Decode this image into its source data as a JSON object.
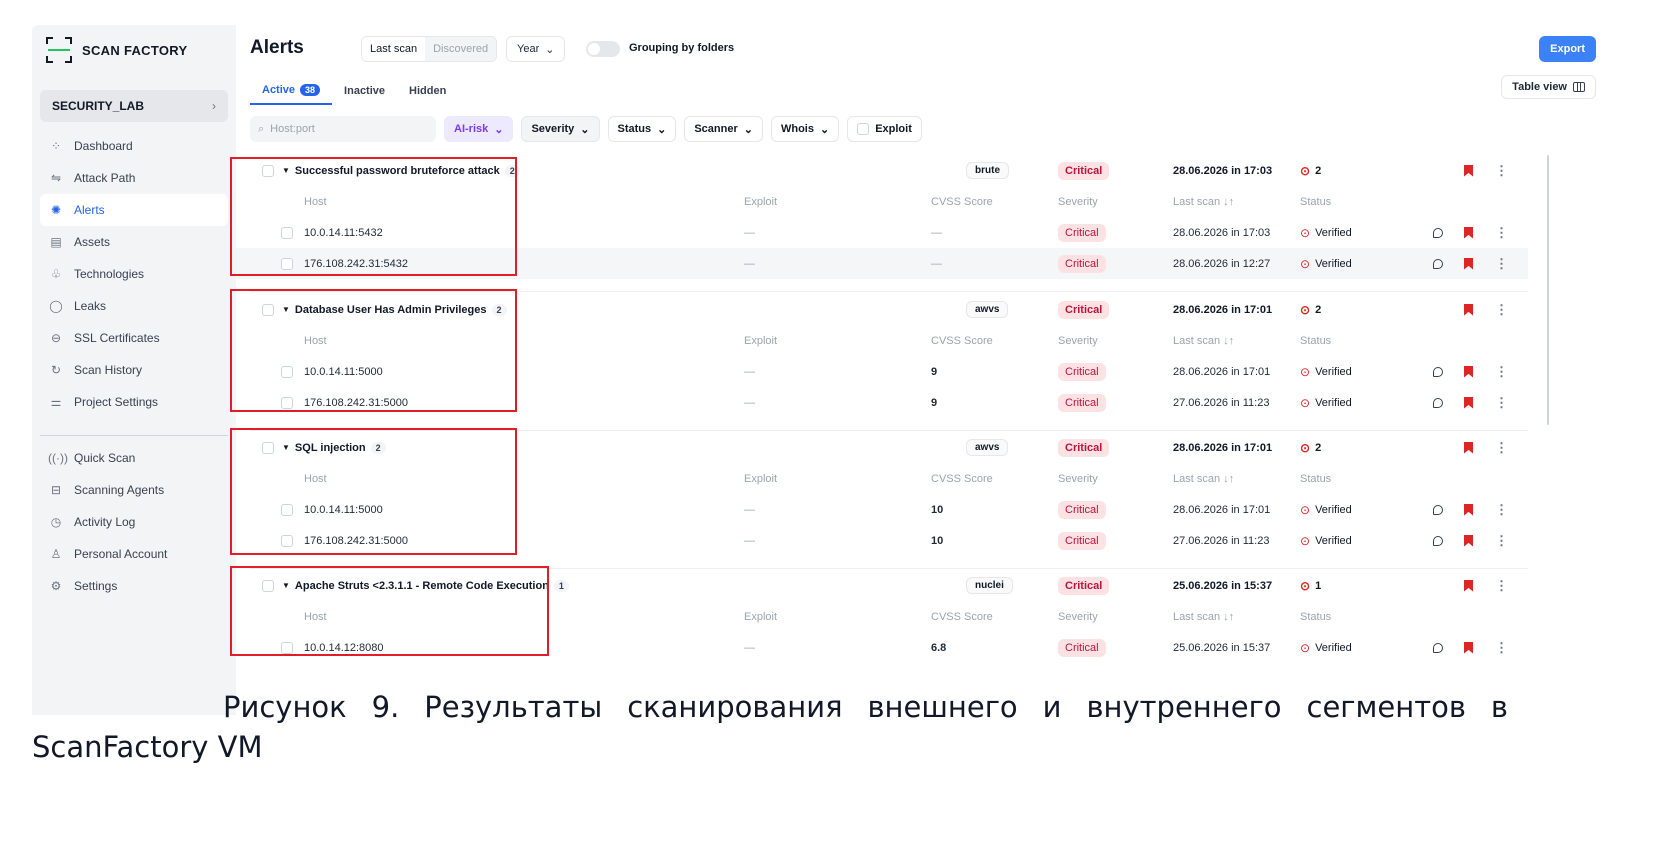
{
  "brand": {
    "name": "SCAN FACTORY",
    "accent": "#22c55e"
  },
  "project": {
    "name": "SECURITY_LAB"
  },
  "nav": [
    {
      "label": "Dashboard",
      "icon": "dashboard-icon",
      "glyph": "⁘"
    },
    {
      "label": "Attack Path",
      "icon": "route-icon",
      "glyph": "⇋"
    },
    {
      "label": "Alerts",
      "icon": "bug-icon",
      "glyph": "✺",
      "active": true
    },
    {
      "label": "Assets",
      "icon": "server-icon",
      "glyph": "▤"
    },
    {
      "label": "Technologies",
      "icon": "graph-icon",
      "glyph": "♧"
    },
    {
      "label": "Leaks",
      "icon": "drop-icon",
      "glyph": "◯"
    },
    {
      "label": "SSL Certificates",
      "icon": "lock-icon",
      "glyph": "⊖"
    },
    {
      "label": "Scan History",
      "icon": "history-icon",
      "glyph": "↻"
    },
    {
      "label": "Project Settings",
      "icon": "sliders-icon",
      "glyph": "⚌"
    }
  ],
  "nav2": [
    {
      "label": "Quick Scan",
      "icon": "radar-icon",
      "glyph": "((·))"
    },
    {
      "label": "Scanning Agents",
      "icon": "agent-icon",
      "glyph": "⊟"
    },
    {
      "label": "Activity Log",
      "icon": "clock-icon",
      "glyph": "◷"
    },
    {
      "label": "Personal Account",
      "icon": "user-icon",
      "glyph": "♙"
    },
    {
      "label": "Settings",
      "icon": "gear-icon",
      "glyph": "⚙"
    }
  ],
  "header": {
    "title": "Alerts",
    "seg_on": "Last scan",
    "seg_off": "Discovered",
    "year": "Year",
    "grouping": "Grouping by folders",
    "export": "Export",
    "table_view": "Table view"
  },
  "tabs": {
    "active": "Active",
    "active_count": "38",
    "inactive": "Inactive",
    "hidden": "Hidden"
  },
  "filters": {
    "search_placeholder": "Host:port",
    "ai_risk": "AI-risk",
    "severity": "Severity",
    "status": "Status",
    "scanner": "Scanner",
    "whois": "Whois",
    "exploit": "Exploit"
  },
  "columns": {
    "host": "Host",
    "exploit": "Exploit",
    "cvss": "CVSS Score",
    "severity": "Severity",
    "last_scan": "Last scan ↓↑",
    "status": "Status"
  },
  "colors": {
    "critical_bg": "#fde2e4",
    "critical_text": "#be123c",
    "primary": "#3b82f6",
    "highlight": "#e11d2a"
  },
  "groups": [
    {
      "title": "Successful password bruteforce attack",
      "count": "2",
      "source": "brute",
      "severity": "Critical",
      "last_scan": "28.06.2026 in 17:03",
      "status": "2",
      "rows": [
        {
          "host": "10.0.14.11:5432",
          "exploit": "—",
          "cvss": "—",
          "severity": "Critical",
          "last_scan": "28.06.2026 in 17:03",
          "status": "Verified"
        },
        {
          "host": "176.108.242.31:5432",
          "exploit": "—",
          "cvss": "—",
          "severity": "Critical",
          "last_scan": "28.06.2026 in 12:27",
          "status": "Verified"
        }
      ]
    },
    {
      "title": "Database User Has Admin Privileges",
      "count": "2",
      "source": "awvs",
      "severity": "Critical",
      "last_scan": "28.06.2026 in 17:01",
      "status": "2",
      "rows": [
        {
          "host": "10.0.14.11:5000",
          "exploit": "—",
          "cvss": "9",
          "severity": "Critical",
          "last_scan": "28.06.2026 in 17:01",
          "status": "Verified"
        },
        {
          "host": "176.108.242.31:5000",
          "exploit": "—",
          "cvss": "9",
          "severity": "Critical",
          "last_scan": "27.06.2026 in 11:23",
          "status": "Verified"
        }
      ]
    },
    {
      "title": "SQL injection",
      "count": "2",
      "source": "awvs",
      "severity": "Critical",
      "last_scan": "28.06.2026 in 17:01",
      "status": "2",
      "rows": [
        {
          "host": "10.0.14.11:5000",
          "exploit": "—",
          "cvss": "10",
          "severity": "Critical",
          "last_scan": "28.06.2026 in 17:01",
          "status": "Verified"
        },
        {
          "host": "176.108.242.31:5000",
          "exploit": "—",
          "cvss": "10",
          "severity": "Critical",
          "last_scan": "27.06.2026 in 11:23",
          "status": "Verified"
        }
      ]
    },
    {
      "title": "Apache Struts <2.3.1.1 - Remote Code Execution",
      "count": "1",
      "source": "nuclei",
      "severity": "Critical",
      "last_scan": "25.06.2026 in 15:37",
      "status": "1",
      "rows": [
        {
          "host": "10.0.14.12:8080",
          "exploit": "—",
          "cvss": "6.8",
          "severity": "Critical",
          "last_scan": "25.06.2026 in 15:37",
          "status": "Verified"
        }
      ]
    }
  ],
  "caption": {
    "line1_words": [
      "Рисунок",
      "9.",
      "Результаты",
      "сканирования",
      "внешнего",
      "и",
      "внутреннего",
      "сегментов",
      "в"
    ],
    "line2": "ScanFactory VM"
  }
}
